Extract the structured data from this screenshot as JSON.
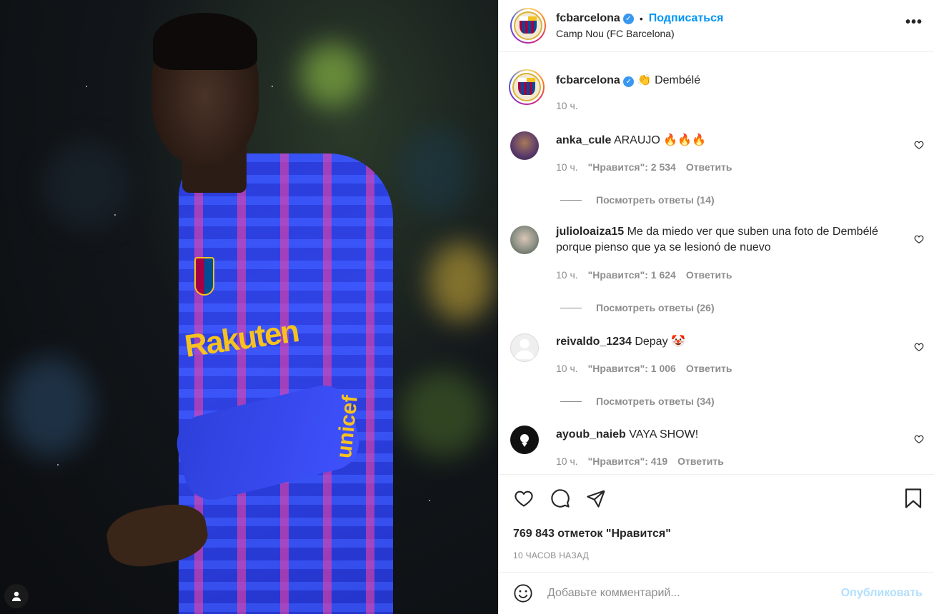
{
  "post": {
    "username": "fcbarcelona",
    "follow_label": "Подписаться",
    "location": "Camp Nou (FC Barcelona)",
    "more_label": "•••",
    "dot": "•",
    "photo_sponsor": "Rakuten",
    "caption_emoji": "👏",
    "caption_text": "Dembélé",
    "caption_time": "10 ч."
  },
  "comments": [
    {
      "user": "anka_cule",
      "text": "ARAUJO 🔥🔥🔥",
      "time": "10 ч.",
      "likes": "\"Нравится\": 2 534",
      "reply": "Ответить",
      "replies": "Посмотреть ответы (14)",
      "avatar_color": "#5a3a6a"
    },
    {
      "user": "julioloaiza15",
      "text": "Me da miedo ver que suben una foto de Dembélé porque pienso que ya se lesionó de nuevo",
      "time": "10 ч.",
      "likes": "\"Нравится\": 1 624",
      "reply": "Ответить",
      "replies": "Посмотреть ответы (26)",
      "avatar_color": "#8a8f84"
    },
    {
      "user": "reivaldo_1234",
      "text": "Depay 🤡",
      "time": "10 ч.",
      "likes": "\"Нравится\": 1 006",
      "reply": "Ответить",
      "replies": "Посмотреть ответы (34)",
      "avatar_color": "#e6e6e6"
    },
    {
      "user": "ayoub_naieb",
      "text": "VAYA SHOW!",
      "time": "10 ч.",
      "likes": "\"Нравится\": 419",
      "reply": "Ответить",
      "replies": "",
      "avatar_color": "#111111"
    }
  ],
  "footer": {
    "likes_count": "769 843 отметок \"Нравится\"",
    "time_ago": "10 ЧАСОВ НАЗАД",
    "comment_placeholder": "Добавьте комментарий...",
    "publish_label": "Опубликовать"
  },
  "icons": {
    "heart": "heart-icon",
    "comment": "comment-icon",
    "share": "share-icon",
    "save": "bookmark-icon",
    "emoji": "emoji-icon",
    "more": "more-icon",
    "verified": "verified-icon",
    "user_tag": "user-tag-icon"
  },
  "colors": {
    "link_blue": "#0095f6",
    "verified_blue": "#3897f0",
    "muted": "#8e8e8e",
    "publish_disabled": "#b2dffc"
  }
}
